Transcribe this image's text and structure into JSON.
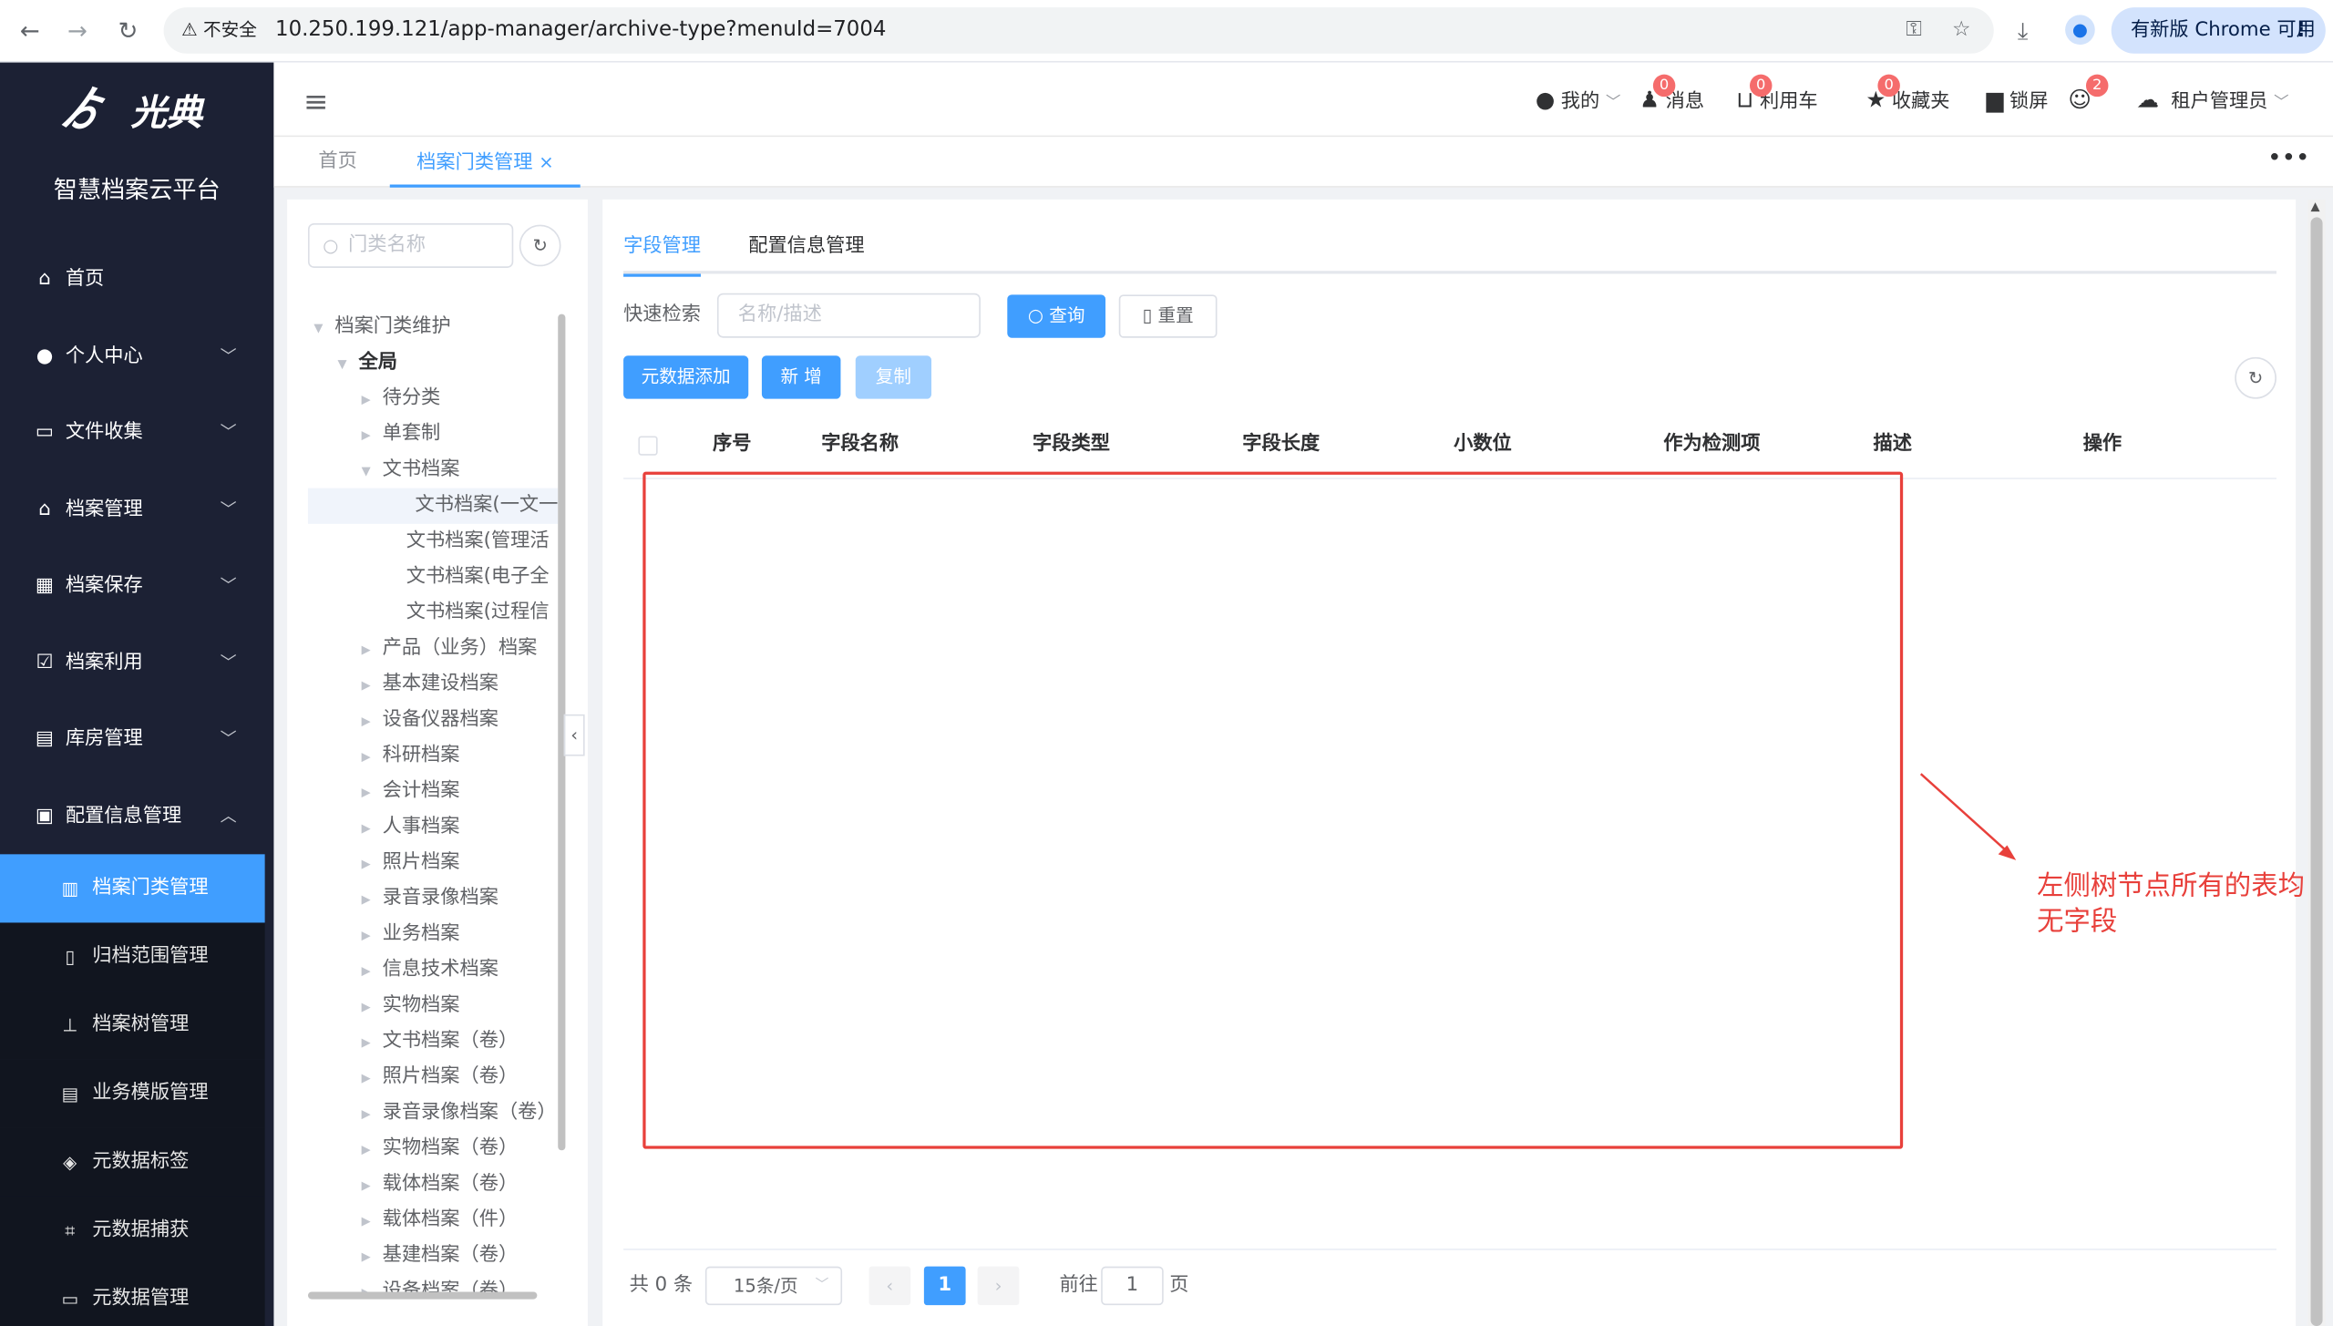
{
  "browser": {
    "insecure_label": "不安全",
    "url": "10.250.199.121/app-manager/archive-type?menuId=7004",
    "update_label": "有新版 Chrome 可用"
  },
  "sidebar": {
    "logo_text": "光典",
    "platform_title": "智慧档案云平台",
    "menu": [
      {
        "label": "首页",
        "icon": "home-icon"
      },
      {
        "label": "个人中心",
        "icon": "user-icon"
      },
      {
        "label": "文件收集",
        "icon": "box-icon"
      },
      {
        "label": "档案管理",
        "icon": "bank-icon"
      },
      {
        "label": "档案保存",
        "icon": "building-icon"
      },
      {
        "label": "档案利用",
        "icon": "clipboard-check-icon"
      },
      {
        "label": "库房管理",
        "icon": "warehouse-icon"
      },
      {
        "label": "配置信息管理",
        "icon": "clipboard-icon"
      }
    ],
    "submenu": [
      {
        "label": "档案门类管理",
        "icon": "books-icon"
      },
      {
        "label": "归档范围管理",
        "icon": "file-icon"
      },
      {
        "label": "档案树管理",
        "icon": "sitemap-icon"
      },
      {
        "label": "业务模版管理",
        "icon": "template-icon"
      },
      {
        "label": "元数据标签",
        "icon": "tags-icon"
      },
      {
        "label": "元数据捕获",
        "icon": "crop-icon"
      },
      {
        "label": "元数据管理",
        "icon": "list-icon"
      }
    ]
  },
  "header": {
    "mine": "我的",
    "messages": "消息",
    "messages_count": "0",
    "cart": "利用车",
    "cart_count": "0",
    "favorites": "收藏夹",
    "favorites_count": "0",
    "lock": "锁屏",
    "users_count": "2",
    "tenant": "租户管理员"
  },
  "page_tabs": {
    "home": "首页",
    "current": "档案门类管理",
    "close": "×"
  },
  "tree": {
    "search_placeholder": "门类名称",
    "nodes": [
      "档案门类维护",
      "全局",
      "待分类",
      "单套制",
      "文书档案",
      "文书档案(一文一",
      "文书档案(管理活",
      "文书档案(电子全",
      "文书档案(过程信",
      "产品（业务）档案",
      "基本建设档案",
      "设备仪器档案",
      "科研档案",
      "会计档案",
      "人事档案",
      "照片档案",
      "录音录像档案",
      "业务档案",
      "信息技术档案",
      "实物档案",
      "文书档案（卷）",
      "照片档案（卷）",
      "录音录像档案（卷）",
      "实物档案（卷）",
      "载体档案（卷）",
      "载体档案（件）",
      "基建档案（卷）",
      "设备档案（卷）"
    ]
  },
  "main": {
    "tabs": [
      "字段管理",
      "配置信息管理"
    ],
    "quick_search_label": "快速检索",
    "search_placeholder": "名称/描述",
    "query_button": "查询",
    "reset_button": "重置",
    "meta_add_button": "元数据添加",
    "add_button": "新 增",
    "copy_button": "复制",
    "columns": [
      "序号",
      "字段名称",
      "字段类型",
      "字段长度",
      "小数位",
      "作为检测项",
      "描述",
      "操作"
    ],
    "annotation": "左侧树节点所有的表均无字段",
    "pager": {
      "total": "共 0 条",
      "page_size": "15条/页",
      "current_page": "1",
      "goto_label": "前往",
      "goto_value": "1",
      "page_unit": "页"
    }
  },
  "colors": {
    "sidebar_bg": "#1c2134",
    "accent": "#409eff",
    "annotation_red": "#e8403b"
  }
}
